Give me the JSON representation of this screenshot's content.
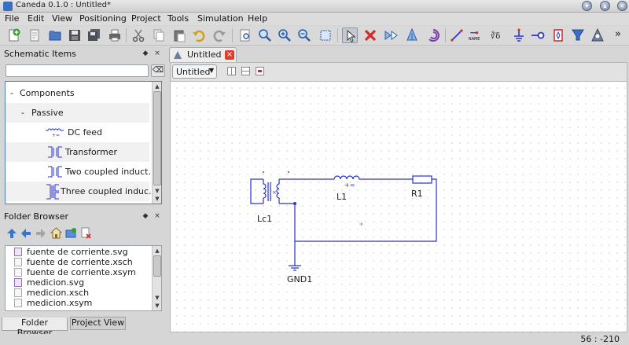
{
  "window": {
    "title": "Caneda 0.1.0 : Untitled*"
  },
  "menu": [
    "File",
    "Edit",
    "View",
    "Positioning",
    "Project",
    "Tools",
    "Simulation",
    "Help"
  ],
  "toolbar": {
    "icons": [
      "new-file-icon",
      "new-document-icon",
      "open-icon",
      "save-icon",
      "save-all-icon",
      "print-icon",
      "cut-icon",
      "copy-icon",
      "paste-icon",
      "undo-icon",
      "redo-icon",
      "zoom-fit-icon",
      "zoom-original-icon",
      "zoom-in-icon",
      "zoom-out-icon",
      "zoom-area-icon",
      "select-icon",
      "delete-icon",
      "mirror-x-icon",
      "mirror-y-icon",
      "rotate-icon",
      "wire-icon",
      "label-icon",
      "equation-icon",
      "ground-icon",
      "port-icon",
      "component-icon",
      "probe-icon",
      "simulate-icon"
    ]
  },
  "schematic_items": {
    "title": "Schematic Items",
    "search_placeholder": "",
    "tree": [
      {
        "label": "Components",
        "expander": "-"
      },
      {
        "label": "Passive",
        "expander": "-"
      },
      {
        "label": "DC feed"
      },
      {
        "label": "Transformer"
      },
      {
        "label": "Two coupled induct..."
      },
      {
        "label": "Three coupled induc..."
      }
    ]
  },
  "folder_browser": {
    "title": "Folder Browser",
    "files": [
      {
        "name": "fuente de corriente.svg",
        "type": "svg"
      },
      {
        "name": "fuente de corriente.xsch",
        "type": "doc"
      },
      {
        "name": "fuente de corriente.xsym",
        "type": "doc"
      },
      {
        "name": "medicion.svg",
        "type": "svg"
      },
      {
        "name": "medicion.xsch",
        "type": "doc"
      },
      {
        "name": "medicion.xsym",
        "type": "doc"
      }
    ],
    "tabs": [
      "Folder Browser",
      "Project View"
    ]
  },
  "document": {
    "tab_label": "Untitled",
    "view_select": "Untitled"
  },
  "schematic": {
    "labels": {
      "coupled": "Lc1",
      "inductor": "L1",
      "resistor": "R1",
      "ground": "GND1"
    }
  },
  "status": {
    "coords": "56 : -210"
  },
  "colors": {
    "wire": "#2b35c8",
    "close_tab": "#e03c2c",
    "selection": "#4b7bc8"
  }
}
